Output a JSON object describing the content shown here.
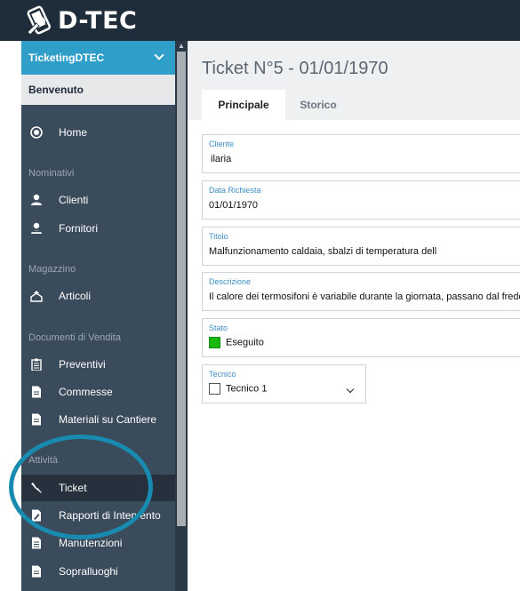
{
  "app": {
    "brand": "D-TEC"
  },
  "sidebar": {
    "header": "TicketingDTEC",
    "welcome": "Benvenuto",
    "home": "Home",
    "sections": {
      "nominativi": "Nominativi",
      "magazzino": "Magazzino",
      "documenti": "Documenti di Vendita",
      "attivita": "Attività"
    },
    "items": {
      "clienti": "Clienti",
      "fornitori": "Fornitori",
      "articoli": "Articoli",
      "preventivi": "Preventivi",
      "commesse": "Commesse",
      "materiali": "Materiali su Cantiere",
      "ticket": "Ticket",
      "rapporti": "Rapporti di Intervento",
      "manutenzioni": "Manutenzioni",
      "sopralluoghi": "Sopralluoghi"
    }
  },
  "main": {
    "title": "Ticket N°5 - 01/01/1970",
    "tabs": [
      "Principale",
      "Storico"
    ],
    "fields": {
      "cliente": {
        "label": "Cliente",
        "value": "ilaria"
      },
      "data": {
        "label": "Data Richiesta",
        "value": "01/01/1970"
      },
      "titolo": {
        "label": "Titolo",
        "value": "Malfunzionamento caldaia, sbalzi di temperatura dell"
      },
      "descrizione": {
        "label": "Descrizione",
        "value": "Il calore dei termosifoni è variabile durante la giornata, passano dal freddo"
      },
      "stato": {
        "label": "Stato",
        "value": "Eseguito",
        "color": "#17b90f"
      },
      "tecnico": {
        "label": "Tecnico",
        "value": "Tecnico 1"
      }
    }
  },
  "colors": {
    "topbar": "#1f2d3a",
    "sidebar": "#3a4b5c",
    "accent": "#2f9fca",
    "highlight_ring": "#1a8bb0"
  }
}
